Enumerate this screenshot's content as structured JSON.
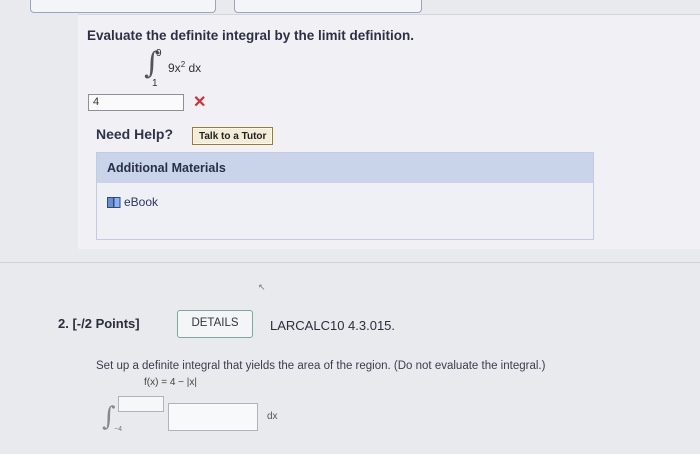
{
  "question1": {
    "prompt": "Evaluate the definite integral by the limit definition.",
    "integral": {
      "upper": "9",
      "lower": "1",
      "integrand": "9x",
      "exponent": "2",
      "differential": "dx"
    },
    "answer_value": "4",
    "answer_status_icon": "cross-icon",
    "need_help": "Need Help?",
    "tutor_button": "Talk to a Tutor",
    "materials": {
      "header": "Additional Materials",
      "ebook": "eBook"
    }
  },
  "question2": {
    "label": "2. [-/2 Points]",
    "details_button": "DETAILS",
    "code": "LARCALC10 4.3.015.",
    "prompt": "Set up a definite integral that yields the area of the region. (Do not evaluate the integral.)",
    "function": "f(x) = 4 − |x|",
    "lower_limit": "−4",
    "differential": "dx",
    "upper_limit_value": "",
    "integrand_value": ""
  },
  "colors": {
    "wrong": "#c8333a",
    "materials_header": "#c9d3ea",
    "details_border": "#7fa89c"
  }
}
